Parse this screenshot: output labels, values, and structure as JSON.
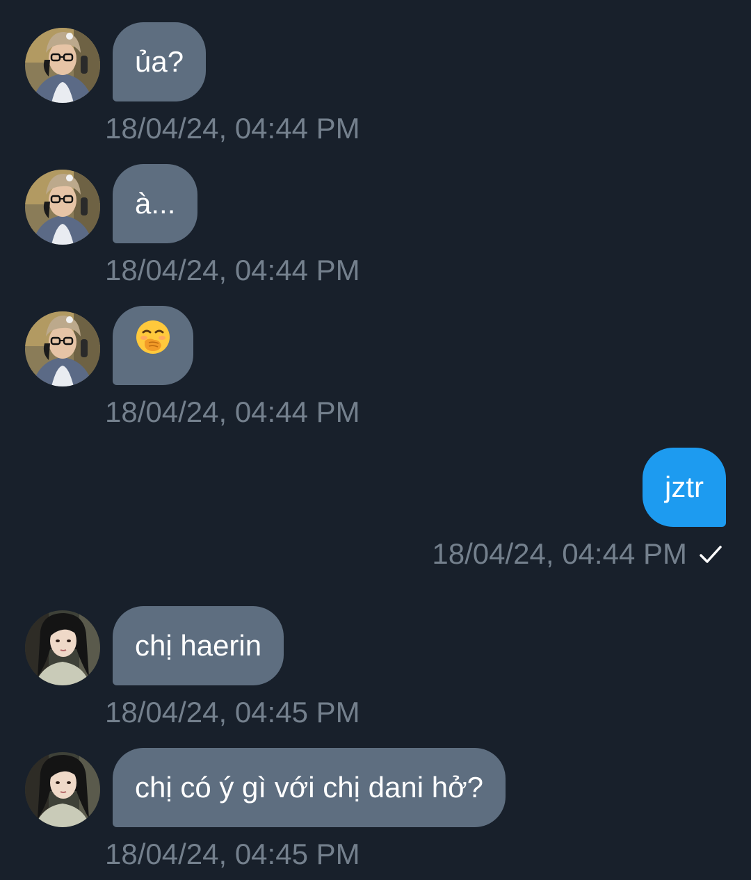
{
  "messages": [
    {
      "side": "incoming",
      "avatar": "avatar-a",
      "text": "ủa?",
      "time": "18/04/24, 04:44 PM"
    },
    {
      "side": "incoming",
      "avatar": "avatar-a",
      "text": "à...",
      "time": "18/04/24, 04:44 PM"
    },
    {
      "side": "incoming",
      "avatar": "avatar-a",
      "text": "",
      "emoji": "face-with-hand-over-mouth",
      "time": "18/04/24, 04:44 PM"
    },
    {
      "side": "outgoing",
      "text": "jztr",
      "time": "18/04/24, 04:44 PM",
      "status": "sent-check-icon"
    },
    {
      "side": "incoming",
      "avatar": "avatar-b",
      "text": "chị haerin",
      "time": "18/04/24, 04:45 PM"
    },
    {
      "side": "incoming",
      "avatar": "avatar-b",
      "text": "chị có ý gì với chị dani hở?",
      "time": "18/04/24, 04:45 PM"
    }
  ],
  "colors": {
    "background": "#18202b",
    "incoming_bubble": "#5e6e80",
    "outgoing_bubble": "#1d9bf0",
    "timestamp": "#74808d"
  }
}
